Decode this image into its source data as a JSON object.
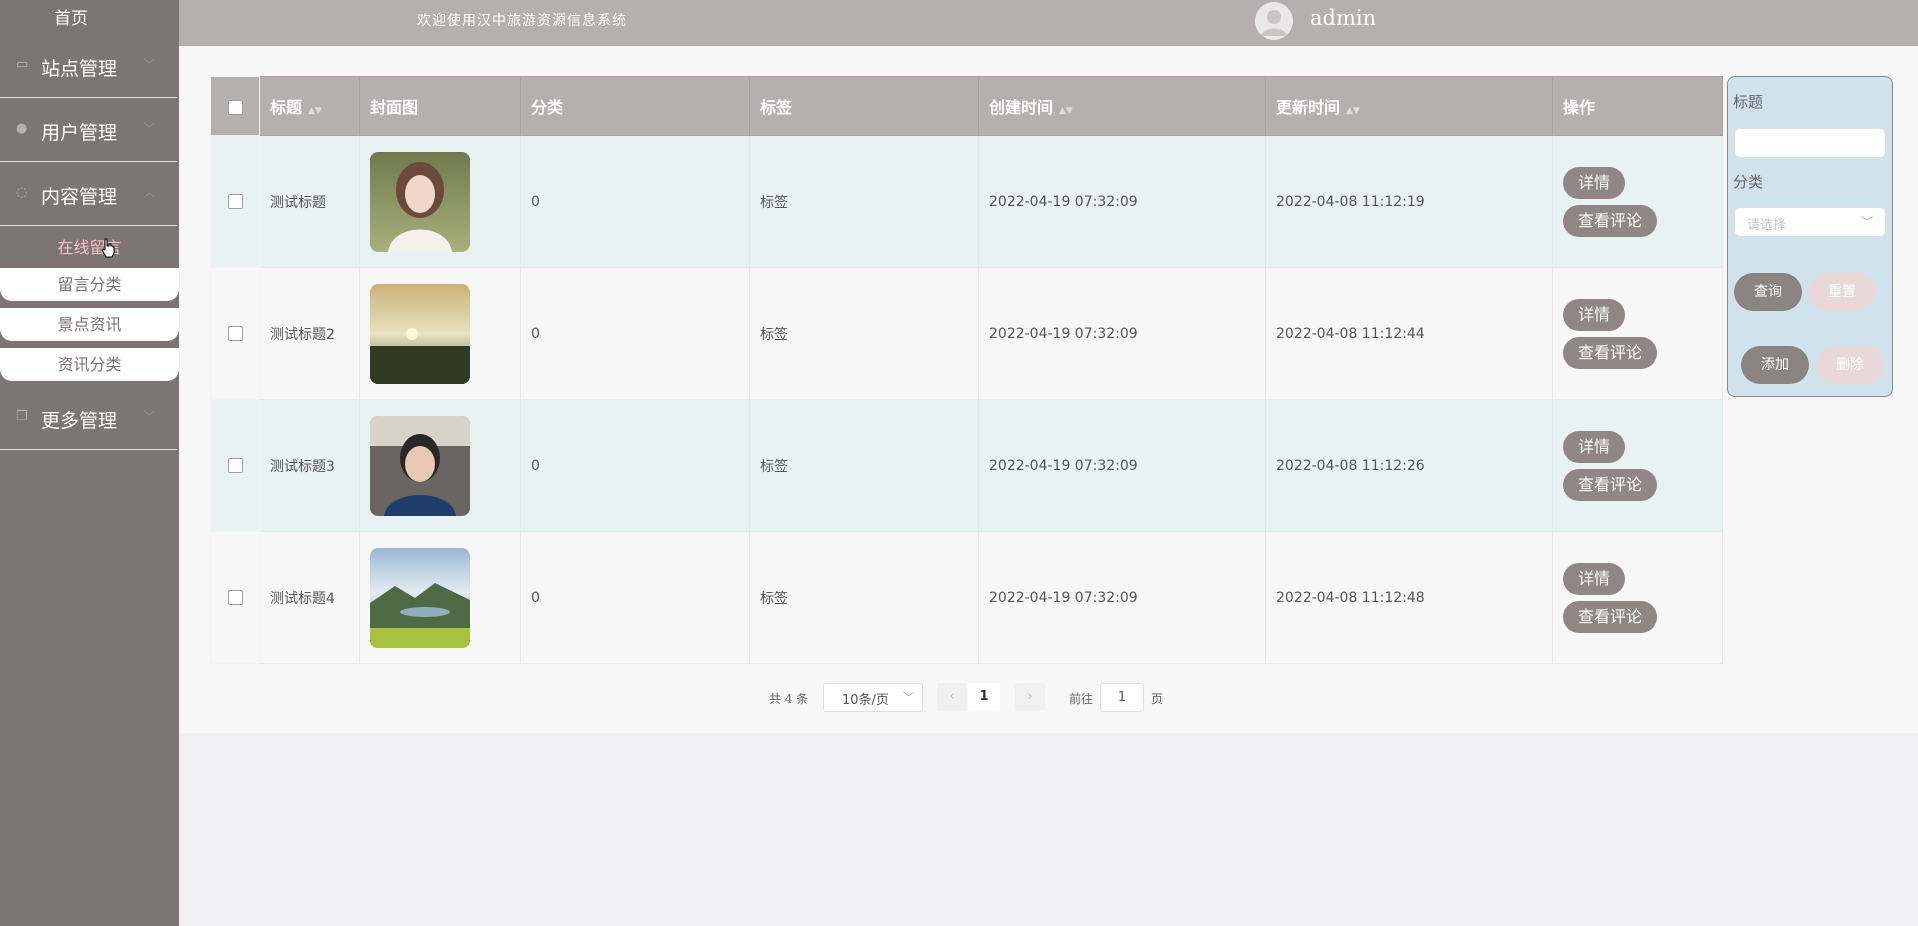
{
  "sidebar": {
    "home": "首页",
    "menus": [
      {
        "label": "站点管理",
        "icon": "monitor-icon"
      },
      {
        "label": "用户管理",
        "icon": "user-icon"
      },
      {
        "label": "内容管理",
        "icon": "chat-icon"
      },
      {
        "label": "更多管理",
        "icon": "copy-icon"
      }
    ],
    "submenu": [
      "在线留言",
      "留言分类",
      "景点资讯",
      "资讯分类"
    ]
  },
  "header": {
    "welcome": "欢迎使用汉中旅游资源信息系统",
    "user": "admin"
  },
  "table": {
    "columns": [
      "标题",
      "封面图",
      "分类",
      "标签",
      "创建时间",
      "更新时间",
      "操作"
    ],
    "rows": [
      {
        "title": "测试标题",
        "category": "0",
        "tag": "标签",
        "created": "2022-04-19 07:32:09",
        "updated": "2022-04-08 11:12:19"
      },
      {
        "title": "测试标题2",
        "category": "0",
        "tag": "标签",
        "created": "2022-04-19 07:32:09",
        "updated": "2022-04-08 11:12:44"
      },
      {
        "title": "测试标题3",
        "category": "0",
        "tag": "标签",
        "created": "2022-04-19 07:32:09",
        "updated": "2022-04-08 11:12:26"
      },
      {
        "title": "测试标题4",
        "category": "0",
        "tag": "标签",
        "created": "2022-04-19 07:32:09",
        "updated": "2022-04-08 11:12:48"
      }
    ],
    "actions": {
      "detail": "详情",
      "comments": "查看评论"
    }
  },
  "filter": {
    "title_label": "标题",
    "category_label": "分类",
    "category_placeholder": "请选择",
    "query": "查询",
    "reset": "重置",
    "add": "添加",
    "delete": "删除"
  },
  "pager": {
    "total": "共 4 条",
    "page_size": "10条/页",
    "current_page": "1",
    "goto_label": "前往",
    "goto_value": "1",
    "page_suffix": "页"
  }
}
